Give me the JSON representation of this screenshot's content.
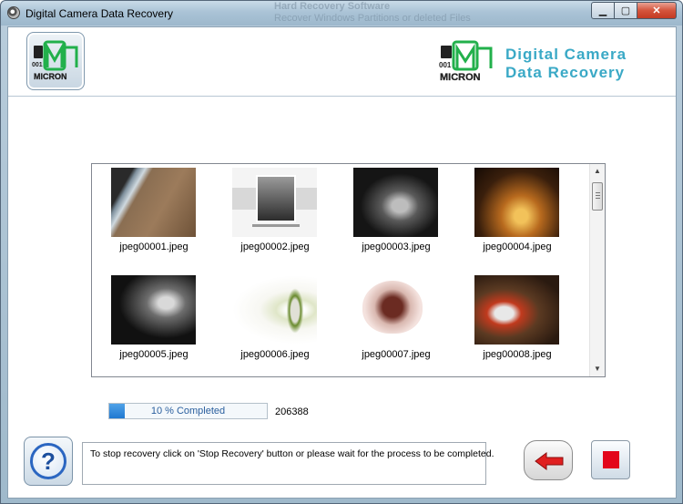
{
  "window": {
    "title": "Digital Camera Data Recovery",
    "ghost_title": "Hard Recovery Software",
    "ghost_subtitle": "Recover Windows Partitions or deleted Files"
  },
  "caption_buttons": {
    "minimize": "▁",
    "maximize": "▢",
    "close": "✕"
  },
  "header": {
    "brand_line1": "Digital Camera",
    "brand_line2": "Data Recovery",
    "logo_text": "MICRON",
    "logo_digits": "001"
  },
  "thumbnails": [
    {
      "label": "jpeg00001.jpeg",
      "theme": "beach"
    },
    {
      "label": "jpeg00002.jpeg",
      "theme": "couple"
    },
    {
      "label": "jpeg00003.jpeg",
      "theme": "dark-bag"
    },
    {
      "label": "jpeg00004.jpeg",
      "theme": "sunset"
    },
    {
      "label": "jpeg00005.jpeg",
      "theme": "portrait"
    },
    {
      "label": "jpeg00006.jpeg",
      "theme": "lilies"
    },
    {
      "label": "jpeg00007.jpeg",
      "theme": "heart"
    },
    {
      "label": "jpeg00008.jpeg",
      "theme": "basketball"
    }
  ],
  "scrollbar": {
    "up": "▲",
    "down": "▼"
  },
  "progress": {
    "text": "10 % Completed",
    "fraction": 0.1,
    "count": "206388"
  },
  "message": "To stop recovery click on 'Stop Recovery' button or please wait for the process to be completed.",
  "help_button": {
    "label": "?"
  },
  "colors": {
    "brand": "#3aa9c6",
    "progress_fill": "#1f78d1",
    "stop": "#e3061b",
    "back_arrow": "#e02020"
  }
}
